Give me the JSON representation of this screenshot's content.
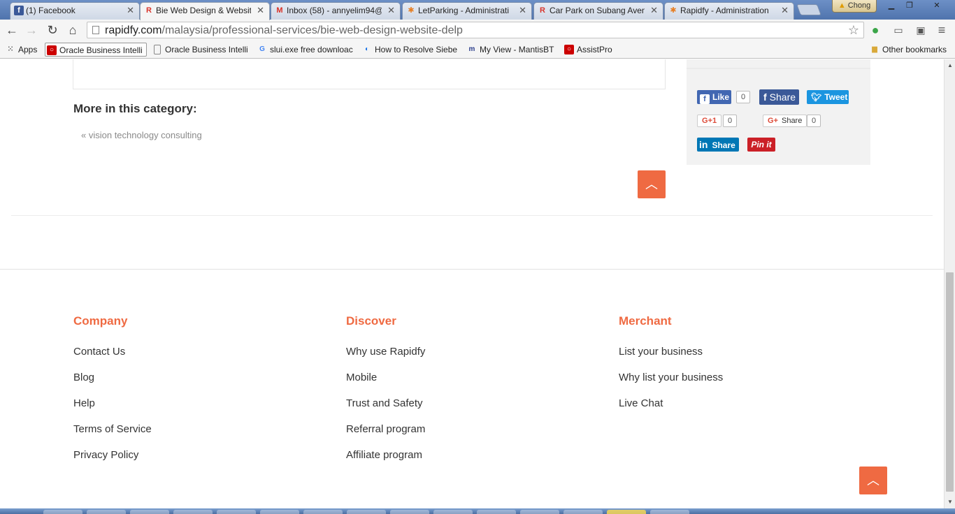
{
  "browser": {
    "tabs": [
      {
        "title": "(1) Facebook",
        "icon": "facebook-icon"
      },
      {
        "title": "Bie Web Design & Website",
        "icon": "rapidfy-icon",
        "active": true
      },
      {
        "title": "Inbox (58) - annyelim94@",
        "icon": "gmail-icon"
      },
      {
        "title": "LetParking - Administrati",
        "icon": "joomla-icon"
      },
      {
        "title": "Car Park on Subang Aven",
        "icon": "rapidfy-icon"
      },
      {
        "title": "Rapidfy - Administration",
        "icon": "joomla-icon"
      }
    ],
    "profile_name": "Chong",
    "url_domain": "rapidfy.com",
    "url_path": "/malaysia/professional-services/bie-web-design-website-delp",
    "bookmarks": [
      {
        "label": "Apps",
        "icon": "apps-grid-icon"
      },
      {
        "label": "Oracle Business Intelli",
        "icon": "oracle-icon"
      },
      {
        "label": "Oracle Business Intelli",
        "icon": "page-icon"
      },
      {
        "label": "slui.exe free downloac",
        "icon": "google-icon"
      },
      {
        "label": "How to Resolve Siebe",
        "icon": "chrome-web-icon"
      },
      {
        "label": "My View - MantisBT",
        "icon": "mantis-icon"
      },
      {
        "label": "AssistPro",
        "icon": "oracle-icon"
      }
    ],
    "other_bookmarks": "Other bookmarks"
  },
  "main": {
    "more_title": "More in this category:",
    "prev_link": "« vision technology consulting"
  },
  "social": {
    "fb_like": "Like",
    "fb_like_count": "0",
    "fb_share": "Share",
    "tweet": "Tweet",
    "gplus": "+1",
    "gplus_count": "0",
    "gshare": "Share",
    "gshare_count": "0",
    "linkedin": "Share",
    "pinit": "Pin it"
  },
  "footer": {
    "company": {
      "heading": "Company",
      "links": [
        "Contact Us",
        "Blog",
        "Help",
        "Terms of Service",
        "Privacy Policy"
      ]
    },
    "discover": {
      "heading": "Discover",
      "links": [
        "Why use Rapidfy",
        "Mobile",
        "Trust and Safety",
        "Referral program",
        "Affiliate program"
      ]
    },
    "merchant": {
      "heading": "Merchant",
      "links": [
        "List your business",
        "Why list your business",
        "Live Chat"
      ]
    }
  },
  "colors": {
    "accent": "#ef6a42",
    "facebook": "#3b5998",
    "twitter": "#1da1f2",
    "linkedin": "#0077b5",
    "pinterest": "#cb2027"
  }
}
